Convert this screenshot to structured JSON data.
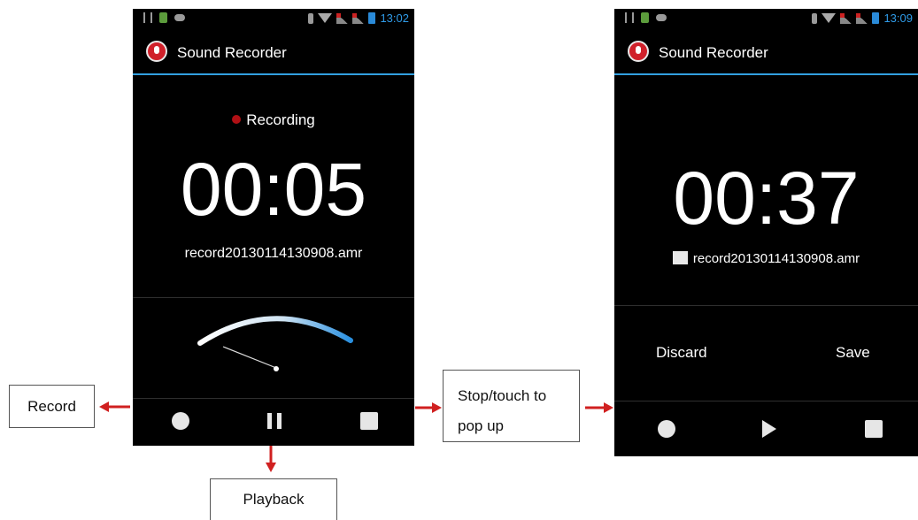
{
  "phones": [
    {
      "status_time": "13:02",
      "app_title": "Sound Recorder",
      "state_label": "Recording",
      "timer": "00:05",
      "filename": "record20130114130908.amr",
      "controls": [
        "record",
        "pause",
        "stop"
      ]
    },
    {
      "status_time": "13:09",
      "app_title": "Sound Recorder",
      "timer": "00:37",
      "filename": "record20130114130908.amr",
      "discard_label": "Discard",
      "save_label": "Save",
      "controls": [
        "record",
        "play",
        "stop"
      ]
    }
  ],
  "annotations": {
    "record": "Record",
    "stop_line1": "Stop/touch to",
    "stop_line2": "pop up",
    "playback": "Playback"
  },
  "colors": {
    "accent": "#32a0e0",
    "recording_dot": "#b01015",
    "arrow": "#d02020",
    "app_icon": "#d0202a"
  },
  "icons": [
    "usb-icon",
    "battery-small-icon",
    "cloud-icon",
    "bluetooth-icon",
    "wifi-icon",
    "signal-icon",
    "battery-icon",
    "app-mic-icon",
    "record-icon",
    "pause-icon",
    "stop-icon",
    "play-icon",
    "vu-meter"
  ]
}
